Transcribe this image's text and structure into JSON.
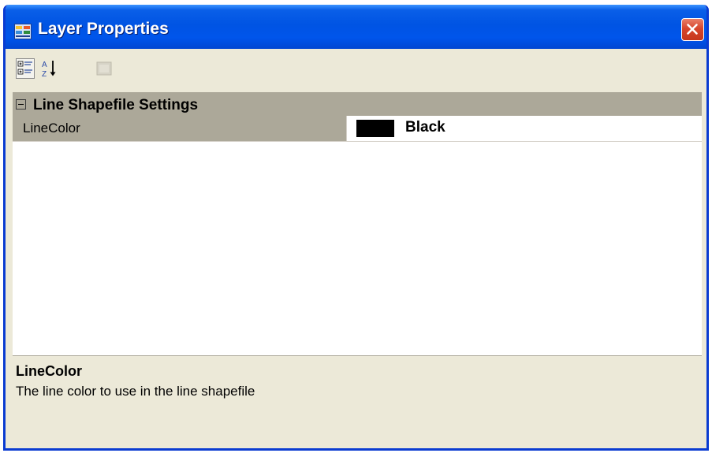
{
  "window": {
    "title": "Layer Properties",
    "icon": "layer-properties-icon",
    "close_icon": "close-icon"
  },
  "toolbar": {
    "items": [
      {
        "icon": "categorized-icon",
        "enabled": true
      },
      {
        "icon": "alphabetical-sort-icon",
        "enabled": true
      },
      {
        "icon": "property-pages-icon",
        "enabled": false
      }
    ]
  },
  "grid": {
    "category": {
      "label": "Line Shapefile Settings",
      "expanded": true
    },
    "properties": [
      {
        "name": "LineColor",
        "value": "Black",
        "swatch_color": "#000000"
      }
    ]
  },
  "help": {
    "title": "LineColor",
    "description": "The line color to use in the line shapefile"
  },
  "colors": {
    "title_bar": "#0054e3",
    "window_bg": "#ece9d8",
    "category_bg": "#aca899",
    "close_button": "#d7462c"
  }
}
